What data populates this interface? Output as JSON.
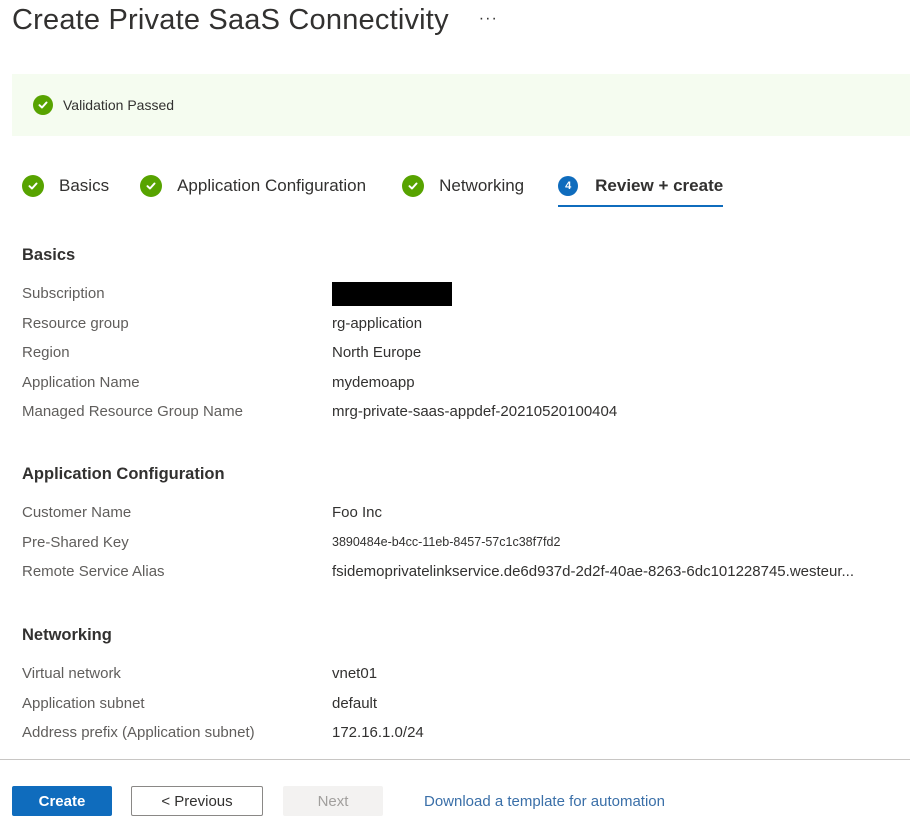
{
  "header": {
    "title": "Create Private SaaS Connectivity",
    "more_label": "···"
  },
  "validation": {
    "icon": "check-circle-icon",
    "text": "Validation Passed",
    "status_color": "#57a300"
  },
  "steps": [
    {
      "label": "Basics",
      "state": "complete",
      "icon": "check-circle-icon"
    },
    {
      "label": "Application Configuration",
      "state": "complete",
      "icon": "check-circle-icon"
    },
    {
      "label": "Networking",
      "state": "complete",
      "icon": "check-circle-icon"
    },
    {
      "label": "Review + create",
      "state": "active",
      "number": "4"
    }
  ],
  "sections": {
    "basics": {
      "title": "Basics",
      "rows": [
        {
          "label": "Subscription",
          "value": "[redacted]"
        },
        {
          "label": "Resource group",
          "value": "rg-application"
        },
        {
          "label": "Region",
          "value": "North Europe"
        },
        {
          "label": "Application Name",
          "value": "mydemoapp"
        },
        {
          "label": "Managed Resource Group Name",
          "value": "mrg-private-saas-appdef-20210520100404"
        }
      ]
    },
    "app_config": {
      "title": "Application Configuration",
      "rows": [
        {
          "label": "Customer Name",
          "value": "Foo Inc"
        },
        {
          "label": "Pre-Shared Key",
          "value": "3890484e-b4cc-11eb-8457-57c1c38f7fd2"
        },
        {
          "label": "Remote Service Alias",
          "value": "fsidemoprivatelinkservice.de6d937d-2d2f-40ae-8263-6dc101228745.westeur..."
        }
      ]
    },
    "networking": {
      "title": "Networking",
      "rows": [
        {
          "label": "Virtual network",
          "value": "vnet01"
        },
        {
          "label": "Application subnet",
          "value": "default"
        },
        {
          "label": "Address prefix (Application subnet)",
          "value": "172.16.1.0/24"
        }
      ]
    }
  },
  "footer": {
    "create_label": "Create",
    "previous_label": "< Previous",
    "next_label": "Next",
    "download_link": "Download a template for automation"
  },
  "colors": {
    "accent": "#0f6cbd",
    "success": "#57a300",
    "banner_bg": "#f5fcf0",
    "link": "#3a6fa8"
  }
}
